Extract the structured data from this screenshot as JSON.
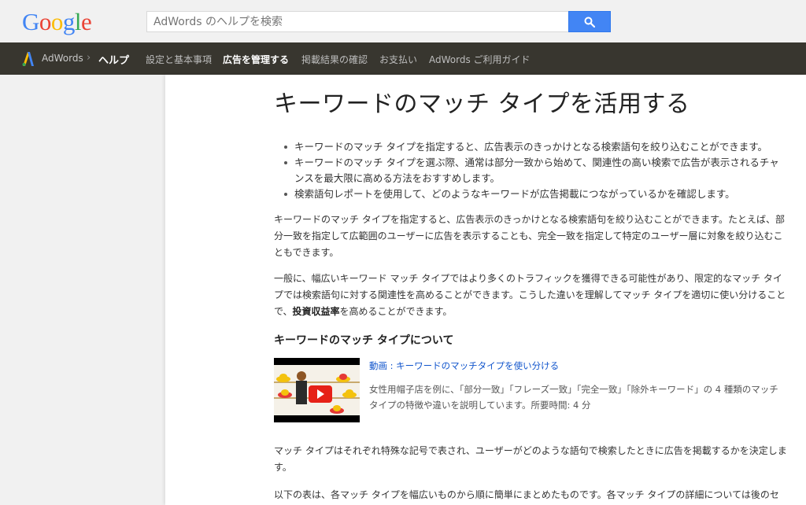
{
  "header": {
    "logo_letters": [
      "G",
      "o",
      "o",
      "g",
      "l",
      "e"
    ],
    "logo_colors": [
      "#4285f4",
      "#ea4335",
      "#fbbc05",
      "#4285f4",
      "#34a853",
      "#ea4335"
    ],
    "search_placeholder": "AdWords のヘルプを検索",
    "search_icon": "search-icon"
  },
  "nav": {
    "product": "AdWords",
    "separator": "›",
    "help": "ヘルプ",
    "items": [
      {
        "label": "設定と基本事項",
        "active": false
      },
      {
        "label": "広告を管理する",
        "active": true
      },
      {
        "label": "掲載結果の確認",
        "active": false
      },
      {
        "label": "お支払い",
        "active": false
      },
      {
        "label": "AdWords ご利用ガイド",
        "active": false
      }
    ]
  },
  "article": {
    "title": "キーワードのマッチ タイプを活用する",
    "bullets": [
      "キーワードのマッチ タイプを指定すると、広告表示のきっかけとなる検索語句を絞り込むことができます。",
      "キーワードのマッチ タイプを選ぶ際、通常は部分一致から始めて、関連性の高い検索で広告が表示されるチャンスを最大限に高める方法をおすすめします。",
      "検索語句レポートを使用して、どのようなキーワードが広告掲載につながっているかを確認します。"
    ],
    "para1": "キーワードのマッチ タイプを指定すると、広告表示のきっかけとなる検索語句を絞り込むことができます。たとえば、部分一致を指定して広範囲のユーザーに広告を表示することも、完全一致を指定して特定のユーザー層に対象を絞り込むこともできます。",
    "para2_before": "一般に、幅広いキーワード マッチ タイプではより多くのトラフィックを獲得できる可能性があり、限定的なマッチ タイプでは検索語句に対する関連性を高めることができます。こうした違いを理解してマッチ タイプを適切に使い分けることで、",
    "para2_bold": "投資収益率",
    "para2_after": "を高めることができます。",
    "section_title": "キーワードのマッチ タイプについて",
    "video_title": "動画 : キーワードのマッチタイプを使い分ける",
    "video_desc": "女性用帽子店を例に、「部分一致」「フレーズ一致」「完全一致」「除外キーワード」の 4 種類のマッチタイプの特徴や違いを説明しています。所要時間: 4 分",
    "para3": "マッチ タイプはそれぞれ特殊な記号で表され、ユーザーがどのような語句で検索したときに広告を掲載するかを決定します。",
    "para4": "以下の表は、各マッチ タイプを幅広いものから順に簡単にまとめたものです。各マッチ タイプの詳細については後のセクションで説明します。"
  }
}
